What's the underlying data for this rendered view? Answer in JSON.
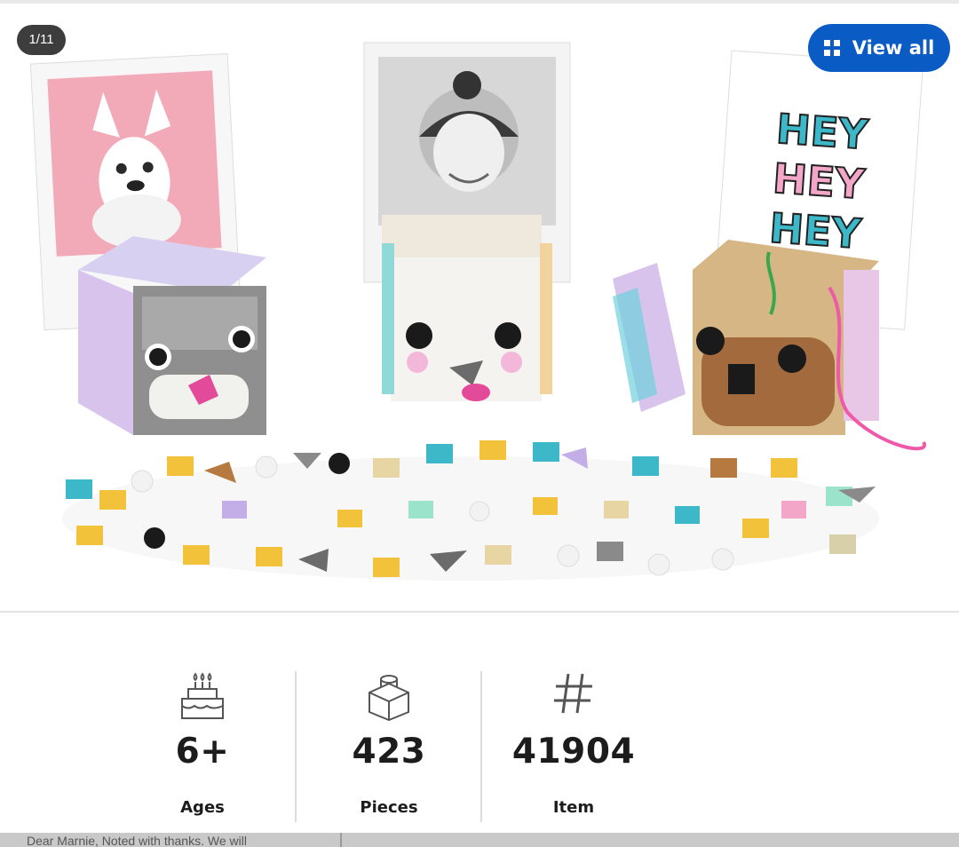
{
  "gallery": {
    "counter": "1/11",
    "view_all_label": "View all",
    "image_alt": "LEGO DOTS Animal Picture Holders set",
    "colors": {
      "view_all_bg": "#0a5bc4",
      "counter_bg": "#3d3d3d"
    }
  },
  "specs": [
    {
      "icon": "birthday-cake-icon",
      "value": "6+",
      "label": "Ages"
    },
    {
      "icon": "brick-icon",
      "value": "423",
      "label": "Pieces"
    },
    {
      "icon": "hash-icon",
      "value": "41904",
      "label": "Item"
    }
  ],
  "comment_preview": "Dear Marnie, Noted with thanks. We will"
}
